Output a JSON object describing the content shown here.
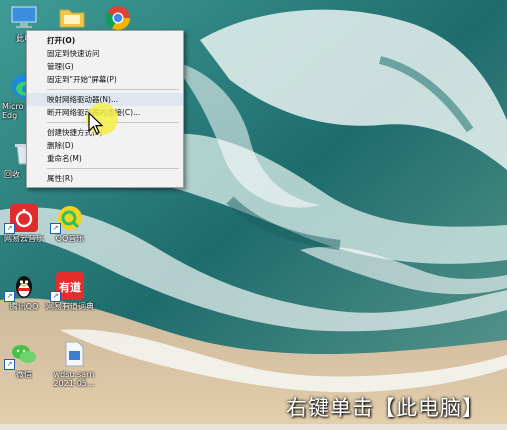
{
  "desktop_icons": [
    {
      "id": "this-pc",
      "label": "此电"
    },
    {
      "id": "folder",
      "label": ""
    },
    {
      "id": "chrome",
      "label": ""
    },
    {
      "id": "edge",
      "label": "Micro Edg"
    },
    {
      "id": "recycle-bin",
      "label": "回收"
    },
    {
      "id": "netease-music",
      "label": "网易云音乐"
    },
    {
      "id": "qq-music",
      "label": "QQ音乐"
    },
    {
      "id": "qq",
      "label": "腾讯QQ"
    },
    {
      "id": "youdao",
      "label": "网易有道词典"
    },
    {
      "id": "wechat",
      "label": "微信"
    },
    {
      "id": "file",
      "label": "wdsu.sarn 2021-05..."
    }
  ],
  "context_menu": {
    "items": [
      {
        "label": "打开(O)",
        "bold": true
      },
      {
        "label": "固定到快速访问"
      },
      {
        "label": "管理(G)"
      },
      {
        "label": "固定到\"开始\"屏幕(P)"
      },
      {
        "label": "映射网络驱动器(N)...",
        "highlighted": true
      },
      {
        "label": "断开网络驱动器的连接(C)..."
      },
      {
        "label": "创建快捷方式(S)"
      },
      {
        "label": "删除(D)"
      },
      {
        "label": "重命名(M)"
      },
      {
        "label": "属性(R)"
      }
    ]
  },
  "caption": "右键单击【此电脑】",
  "colors": {
    "sea": "#1f6f70",
    "foam": "#e8f2f0",
    "sand": "#d9c3a0",
    "highlight": "#f5f046"
  }
}
